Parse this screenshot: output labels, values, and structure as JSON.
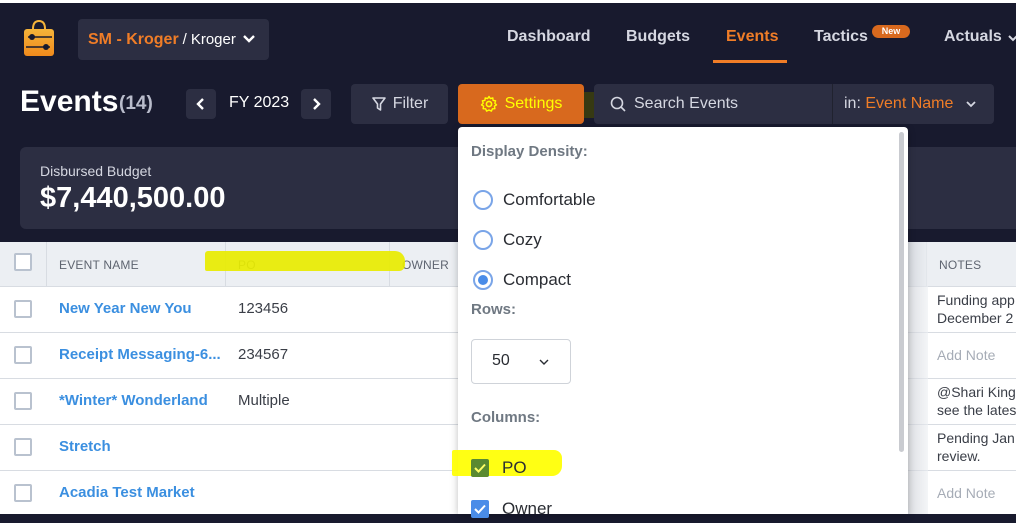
{
  "org": {
    "name": "SM - Kroger",
    "separator": "/",
    "sub": "Kroger"
  },
  "nav": {
    "items": [
      {
        "label": "Dashboard"
      },
      {
        "label": "Budgets"
      },
      {
        "label": "Events",
        "active": true
      },
      {
        "label": "Tactics",
        "badge": "New"
      },
      {
        "label": "Actuals"
      }
    ]
  },
  "page": {
    "title": "Events",
    "count": "(14)"
  },
  "fiscal_year": {
    "label": "FY 2023"
  },
  "toolbar": {
    "filter_label": "Filter",
    "settings_label": "Settings",
    "search_placeholder": "Search Events",
    "search_scope_prefix": "in:",
    "search_scope_value": "Event Name"
  },
  "summary": {
    "label": "Disbursed Budget",
    "value": "$7,440,500.00"
  },
  "table": {
    "columns": [
      "EVENT NAME",
      "PO",
      "OWNER",
      "NOTES"
    ],
    "rows": [
      {
        "name": "New Year New You",
        "po": "123456",
        "notes": [
          "Funding app",
          "December 2"
        ]
      },
      {
        "name": "Receipt Messaging-6...",
        "po": "234567",
        "notes_placeholder": "Add Note"
      },
      {
        "name": "*Winter* Wonderland",
        "po": "Multiple",
        "notes": [
          "@Shari King",
          "see the lates"
        ]
      },
      {
        "name": "Stretch",
        "po": "",
        "notes": [
          "Pending Jan",
          "review."
        ]
      },
      {
        "name": "Acadia Test Market",
        "po": "",
        "notes_placeholder": "Add Note"
      }
    ]
  },
  "settings_menu": {
    "density_heading": "Display Density:",
    "density_options": [
      {
        "label": "Comfortable",
        "selected": false
      },
      {
        "label": "Cozy",
        "selected": false
      },
      {
        "label": "Compact",
        "selected": true
      }
    ],
    "rows_heading": "Rows:",
    "rows_value": "50",
    "columns_heading": "Columns:",
    "columns": [
      {
        "label": "PO",
        "checked": true
      },
      {
        "label": "Owner",
        "checked": true
      }
    ]
  },
  "colors": {
    "accent": "#f07d27",
    "navy": "#181a2e",
    "panel": "#2c2e42",
    "link": "#3b8fe0",
    "highlight": "#e8ec00"
  }
}
